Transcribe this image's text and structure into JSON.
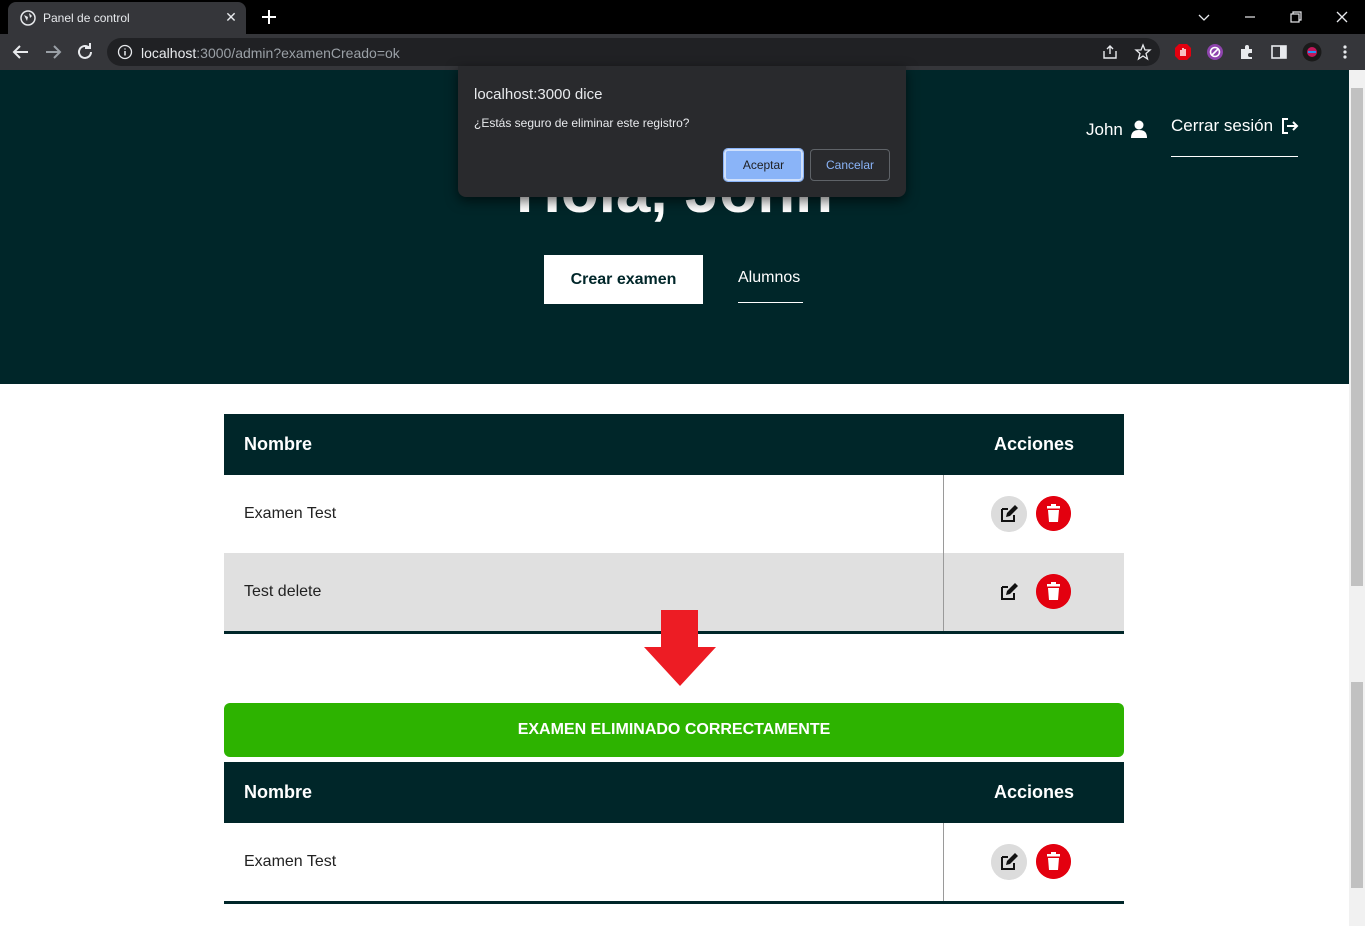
{
  "browser": {
    "tab_title": "Panel de control",
    "tab_close": "✕",
    "url_host": "localhost",
    "url_rest": ":3000/admin?examenCreado=ok"
  },
  "header": {
    "greeting": "Hola, John",
    "user_name": "John",
    "logout_label": "Cerrar sesión",
    "create_exam_label": "Crear examen",
    "students_label": "Alumnos"
  },
  "table_before": {
    "col_name": "Nombre",
    "col_actions": "Acciones",
    "rows": [
      {
        "name": "Examen Test"
      },
      {
        "name": "Test delete"
      }
    ]
  },
  "alert": {
    "message": "EXAMEN ELIMINADO CORRECTAMENTE",
    "color": "#2db300"
  },
  "table_after": {
    "col_name": "Nombre",
    "col_actions": "Acciones",
    "rows": [
      {
        "name": "Examen Test"
      }
    ]
  },
  "dialog": {
    "title": "localhost:3000 dice",
    "message": "¿Estás seguro de eliminar este registro?",
    "ok_label": "Aceptar",
    "cancel_label": "Cancelar"
  },
  "colors": {
    "hero_bg": "#002629",
    "delete_red": "#e3000f",
    "annotation_arrow": "#ed1c24"
  }
}
